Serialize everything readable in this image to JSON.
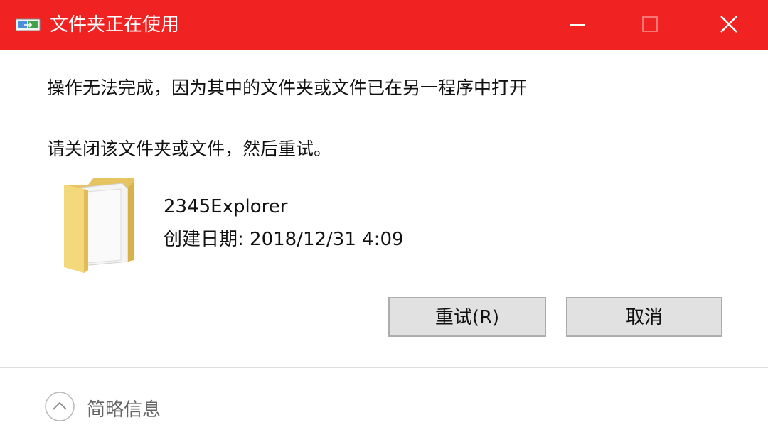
{
  "window": {
    "title": "文件夹正在使用",
    "accent_color": "#f02222"
  },
  "message": {
    "line1": "操作无法完成，因为其中的文件夹或文件已在另一程序中打开",
    "line2": "请关闭该文件夹或文件，然后重试。"
  },
  "file": {
    "name": "2345Explorer",
    "date_label": "创建日期:",
    "date_value": "2018/12/31 4:09",
    "icon": "folder-icon"
  },
  "buttons": {
    "retry_label": "重试(R)",
    "cancel_label": "取消"
  },
  "footer": {
    "details_label": "简略信息",
    "icon": "chevron-up-icon"
  }
}
